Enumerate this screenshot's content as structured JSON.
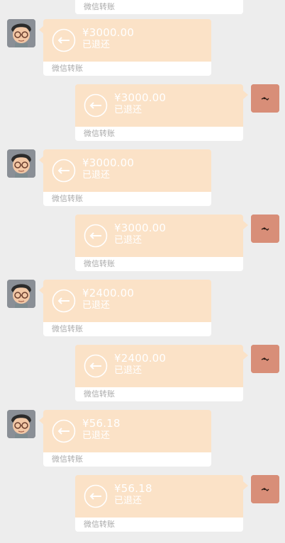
{
  "chat": {
    "top_partial_card": {
      "footer": "微信转账"
    },
    "messages": [
      {
        "side": "left",
        "amount": "¥3000.00",
        "status": "已退还",
        "footer": "微信转账"
      },
      {
        "side": "right",
        "amount": "¥3000.00",
        "status": "已退还",
        "footer": "微信转账"
      },
      {
        "side": "left",
        "amount": "¥3000.00",
        "status": "已退还",
        "footer": "微信转账"
      },
      {
        "side": "right",
        "amount": "¥3000.00",
        "status": "已退还",
        "footer": "微信转账"
      },
      {
        "side": "left",
        "amount": "¥2400.00",
        "status": "已退还",
        "footer": "微信转账"
      },
      {
        "side": "right",
        "amount": "¥2400.00",
        "status": "已退还",
        "footer": "微信转账"
      },
      {
        "side": "left",
        "amount": "¥56.18",
        "status": "已退还",
        "footer": "微信转账"
      },
      {
        "side": "right",
        "amount": "¥56.18",
        "status": "已退还",
        "footer": "微信转账"
      }
    ]
  },
  "colors": {
    "page_bg": "#ededed",
    "card_bg": "#fbe2c7",
    "card_footer_bg": "#ffffff",
    "footer_text": "#a9a9a9",
    "avatar_left_bg": "#8a8f96",
    "avatar_right_bg": "#d88e78"
  },
  "icons": {
    "transfer": "refund-arrow-icon",
    "left_avatar": "cartoon-person-avatar",
    "right_avatar": "orange-avatar"
  }
}
